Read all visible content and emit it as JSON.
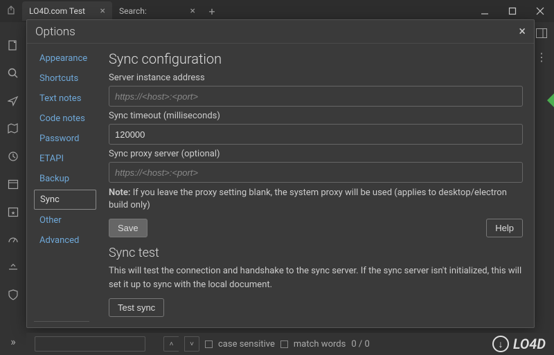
{
  "titlebar": {
    "active_tab": "LO4D.com Test",
    "search_tab": "Search:"
  },
  "dialog": {
    "title": "Options",
    "nav": [
      "Appearance",
      "Shortcuts",
      "Text notes",
      "Code notes",
      "Password",
      "ETAPI",
      "Backup",
      "Sync",
      "Other",
      "Advanced"
    ],
    "selected_nav_index": 7,
    "section1_title": "Sync configuration",
    "server_label": "Server instance address",
    "server_placeholder": "https://<host>:<port>",
    "server_value": "",
    "timeout_label": "Sync timeout (milliseconds)",
    "timeout_value": "120000",
    "proxy_label": "Sync proxy server (optional)",
    "proxy_placeholder": "https://<host>:<port>",
    "proxy_value": "",
    "note_bold": "Note:",
    "note_text": " If you leave the proxy setting blank, the system proxy will be used (applies to desktop/electron build only)",
    "save_btn": "Save",
    "help_btn": "Help",
    "section2_title": "Sync test",
    "section2_desc": "This will test the connection and handshake to the sync server. If the sync server isn't initialized, this will set it up to sync with the local document.",
    "test_btn": "Test sync"
  },
  "findbar": {
    "case_sensitive": "case sensitive",
    "match_words": "match words",
    "counter": "0 / 0"
  },
  "watermark": "LO4D"
}
